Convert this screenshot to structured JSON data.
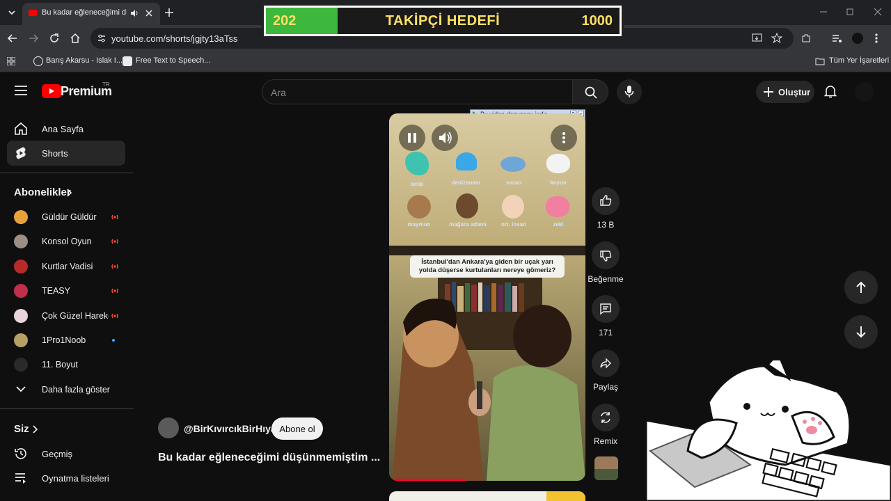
{
  "browser": {
    "tab_title": "Bu kadar eğleneceğimi düşü",
    "url": "youtube.com/shorts/jgjty13aTss",
    "bookmarks": [
      {
        "label": "Barış Akarsu - Islak I..."
      },
      {
        "label": "Free Text to Speech..."
      }
    ],
    "all_bookmarks_label": "Tüm Yer İşaretleri"
  },
  "goal_overlay": {
    "current": "202",
    "label": "TAKİPÇİ HEDEFİ",
    "target": "1000",
    "progress_fraction": 0.202
  },
  "masthead": {
    "logo_text": "Premium",
    "logo_badge": "TR",
    "search_placeholder": "Ara",
    "create_label": "Oluştur"
  },
  "sidebar": {
    "nav": [
      {
        "label": "Ana Sayfa",
        "icon": "home-icon"
      },
      {
        "label": "Shorts",
        "icon": "shorts-icon",
        "active": true
      }
    ],
    "subscriptions_title": "Abonelikler",
    "subscriptions": [
      {
        "label": "Güldür Güldür",
        "live": true,
        "color": "#e8a23a"
      },
      {
        "label": "Konsol Oyun",
        "live": true,
        "color": "#9b8f86"
      },
      {
        "label": "Kurtlar Vadisi",
        "live": true,
        "color": "#b62a2a"
      },
      {
        "label": "TEASY",
        "live": true,
        "color": "#c0304a"
      },
      {
        "label": "Çok Güzel Hareke...",
        "live": true,
        "color": "#e9d4dc"
      },
      {
        "label": "1Pro1Noob",
        "live": false,
        "new": true,
        "color": "#b7a064"
      },
      {
        "label": "11. Boyut",
        "live": false,
        "color": "#2a2a2a"
      }
    ],
    "show_more_label": "Daha fazla göster",
    "you_title": "Siz",
    "you_items": [
      {
        "label": "Geçmiş",
        "icon": "history-icon"
      },
      {
        "label": "Oynatma listeleri",
        "icon": "playlist-icon"
      }
    ]
  },
  "video": {
    "download_bar": "Bu video dosyasını indir",
    "emoji_labels": [
      "amip",
      "denizanası",
      "sazan",
      "koyun",
      "maymun",
      "mağara adamı",
      "ort. insan",
      "zeki"
    ],
    "caption": "İstanbul'dan Ankara'ya giden bir uçak yarı yolda düşerse kurtulanları nereye gömeriz?"
  },
  "actions": {
    "likes": "13 B",
    "dislike_label": "Beğenme",
    "comments": "171",
    "share_label": "Paylaş",
    "remix_label": "Remix"
  },
  "channel": {
    "handle": "@BirKıvırcıkBirHıyar",
    "subscribe_label": "Abone ol",
    "title": "Bu kadar eğleneceğimi düşünmemiştim ..."
  },
  "colors": {
    "background": "#0f0f0f",
    "accent_red": "#ff0000",
    "goal_fill": "#3db83d",
    "goal_text": "#ffe066"
  }
}
